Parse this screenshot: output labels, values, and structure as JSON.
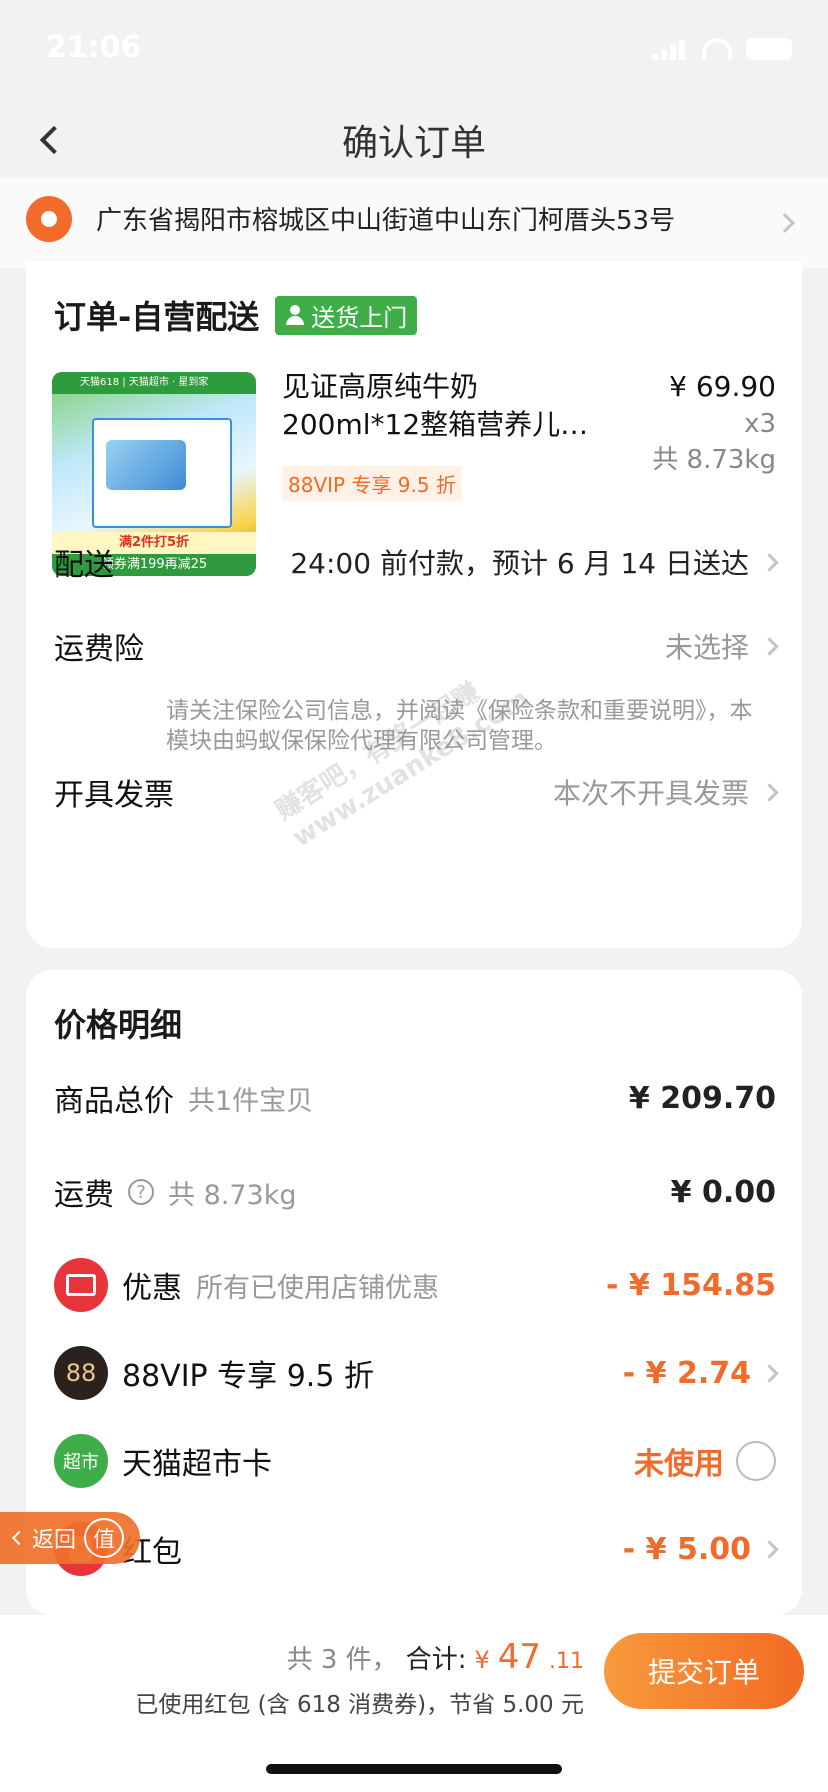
{
  "status_bar": {
    "time": "21:06"
  },
  "nav": {
    "title": "确认订单"
  },
  "address": {
    "text": "广东省揭阳市榕城区中山街道中山东门柯厝头53号"
  },
  "order": {
    "title": "订单-自营配送",
    "badge": "送货上门",
    "product": {
      "image_banner": "天猫618 | 天猫超市 · 星到家",
      "image_promo": "满2件打5折",
      "image_coupon": "领券满199再减25",
      "name_line1": "见证高原纯牛奶",
      "name_line2": "200ml*12整箱营养儿…",
      "vip_tag": "88VIP 专享 9.5 折",
      "unit_price": "¥ 69.90",
      "quantity": "x3",
      "weight": "共 8.73kg"
    },
    "delivery": {
      "label": "配送",
      "value": "24:00 前付款，预计 6 月 14 日送达"
    },
    "insurance": {
      "label": "运费险",
      "value": "未选择",
      "note": "请关注保险公司信息，并阅读《保险条款和重要说明》，本模块由蚂蚁保保险代理有限公司管理。"
    },
    "invoice": {
      "label": "开具发票",
      "value": "本次不开具发票"
    }
  },
  "watermark": {
    "line1": "赚客吧，有奖一起赚",
    "line2": "www.zuanke8.com"
  },
  "price_detail": {
    "title": "价格明细",
    "goods_total": {
      "label": "商品总价",
      "sub": "共1件宝贝",
      "amount": "¥ 209.70"
    },
    "shipping": {
      "label": "运费",
      "help_icon": "?",
      "sub": "共 8.73kg",
      "amount": "¥ 0.00"
    },
    "discount": {
      "label": "优惠",
      "sub": "所有已使用店铺优惠",
      "amount": "- ¥ 154.85"
    },
    "vip": {
      "icon_text": "88",
      "label": "88VIP 专享 9.5 折",
      "amount": "- ¥ 2.74"
    },
    "market_card": {
      "icon_text": "超市",
      "label": "天猫超市卡",
      "status": "未使用"
    },
    "red_packet": {
      "label": "红包",
      "amount": "- ¥ 5.00"
    }
  },
  "float_back": {
    "label": "返回",
    "badge": "值"
  },
  "bottom_bar": {
    "count": "共 3 件，",
    "sum_label": "合计:",
    "sum_yen": "¥",
    "sum_int": "47",
    "sum_dec": ".11",
    "saving": "已使用红包 (含 618 消费券)，节省 5.00 元",
    "submit": "提交订单"
  },
  "colors": {
    "accent": "#f26b2b",
    "green": "#3fae49",
    "red": "#e8353b"
  }
}
